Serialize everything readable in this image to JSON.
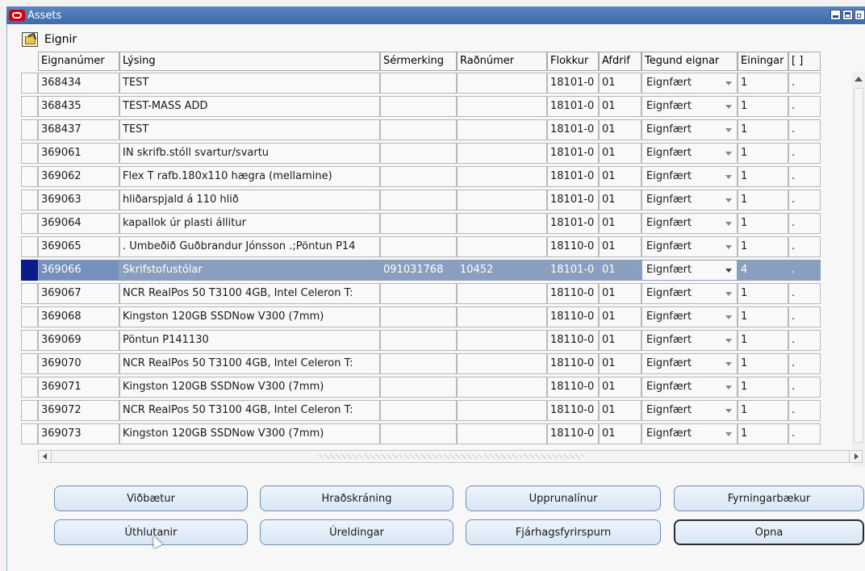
{
  "window": {
    "title": "Assets"
  },
  "block": {
    "title": "Eignir"
  },
  "columns": {
    "asset_number": "Eignanúmer",
    "description": "Lýsing",
    "tag": "Sérmerking",
    "serial": "Raðnúmer",
    "category": "Flokkur",
    "depr": "Afdrif",
    "asset_type": "Tegund eignar",
    "units": "Einingar",
    "extra": "[ ]"
  },
  "rows": [
    {
      "id": "368434",
      "desc": "TEST",
      "tag": "",
      "serial": "",
      "cat": "18101-0",
      "depr": "01",
      "type": "Eignfært",
      "units": "1",
      "extra": "."
    },
    {
      "id": "368435",
      "desc": "TEST-MASS ADD",
      "tag": "",
      "serial": "",
      "cat": "18101-0",
      "depr": "01",
      "type": "Eignfært",
      "units": "1",
      "extra": "."
    },
    {
      "id": "368437",
      "desc": "TEST",
      "tag": "",
      "serial": "",
      "cat": "18101-0",
      "depr": "01",
      "type": "Eignfært",
      "units": "1",
      "extra": "."
    },
    {
      "id": "369061",
      "desc": "IN skrifb.stóll svartur/svartu",
      "tag": "",
      "serial": "",
      "cat": "18101-0",
      "depr": "01",
      "type": "Eignfært",
      "units": "1",
      "extra": "."
    },
    {
      "id": "369062",
      "desc": "Flex T rafb.180x110 hægra (mellamine)",
      "tag": "",
      "serial": "",
      "cat": "18101-0",
      "depr": "01",
      "type": "Eignfært",
      "units": "1",
      "extra": "."
    },
    {
      "id": "369063",
      "desc": "hliðarspjald á 110 hlið",
      "tag": "",
      "serial": "",
      "cat": "18101-0",
      "depr": "01",
      "type": "Eignfært",
      "units": "1",
      "extra": "."
    },
    {
      "id": "369064",
      "desc": "kapallok úr plasti állitur",
      "tag": "",
      "serial": "",
      "cat": "18101-0",
      "depr": "01",
      "type": "Eignfært",
      "units": "1",
      "extra": "."
    },
    {
      "id": "369065",
      "desc": ". Umbeðið Guðbrandur Jónsson .;Pöntun P14",
      "tag": "",
      "serial": "",
      "cat": "18110-0",
      "depr": "01",
      "type": "Eignfært",
      "units": "1",
      "extra": "."
    },
    {
      "id": "369066",
      "desc": "Skrifstofustólar",
      "tag": "091031768",
      "serial": "10452",
      "cat": "18101-0",
      "depr": "01",
      "type": "Eignfært",
      "units": "4",
      "extra": ".",
      "selected": true
    },
    {
      "id": "369067",
      "desc": "NCR RealPos 50 T3100 4GB, Intel Celeron T:",
      "tag": "",
      "serial": "",
      "cat": "18110-0",
      "depr": "01",
      "type": "Eignfært",
      "units": "1",
      "extra": "."
    },
    {
      "id": "369068",
      "desc": "Kingston 120GB SSDNow V300 (7mm)",
      "tag": "",
      "serial": "",
      "cat": "18110-0",
      "depr": "01",
      "type": "Eignfært",
      "units": "1",
      "extra": "."
    },
    {
      "id": "369069",
      "desc": "Pöntun P141130",
      "tag": "",
      "serial": "",
      "cat": "18110-0",
      "depr": "01",
      "type": "Eignfært",
      "units": "1",
      "extra": "."
    },
    {
      "id": "369070",
      "desc": "NCR RealPos 50 T3100 4GB, Intel Celeron T:",
      "tag": "",
      "serial": "",
      "cat": "18110-0",
      "depr": "01",
      "type": "Eignfært",
      "units": "1",
      "extra": "."
    },
    {
      "id": "369071",
      "desc": "Kingston 120GB SSDNow V300 (7mm)",
      "tag": "",
      "serial": "",
      "cat": "18110-0",
      "depr": "01",
      "type": "Eignfært",
      "units": "1",
      "extra": "."
    },
    {
      "id": "369072",
      "desc": "NCR RealPos 50 T3100 4GB, Intel Celeron T:",
      "tag": "",
      "serial": "",
      "cat": "18110-0",
      "depr": "01",
      "type": "Eignfært",
      "units": "1",
      "extra": "."
    },
    {
      "id": "369073",
      "desc": "Kingston 120GB SSDNow V300 (7mm)",
      "tag": "",
      "serial": "",
      "cat": "18110-0",
      "depr": "01",
      "type": "Eignfært",
      "units": "1",
      "extra": "."
    }
  ],
  "buttons": {
    "additions": "Viðbætur",
    "quick_entry": "Hraðskráning",
    "source_lines": "Upprunalínur",
    "depr_books": "Fyrningarbækur",
    "assignments": "Úthlutanir",
    "retirements": "Úreldingar",
    "financial_inquiry": "Fjárhagsfyrirspurn",
    "open": "Opna"
  },
  "colors": {
    "title_bar": "#3d6aa9",
    "selected_row": "#8a9fbe",
    "selected_indicator": "#0b1a8c",
    "button_border": "#6c8fb8"
  }
}
